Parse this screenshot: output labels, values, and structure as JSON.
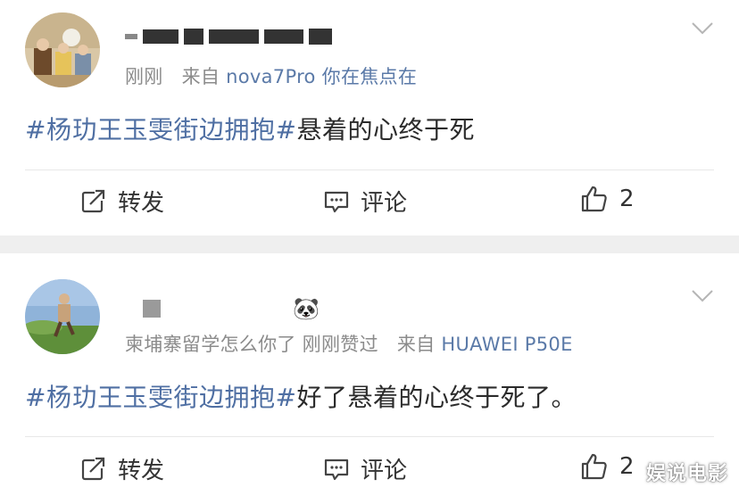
{
  "colors": {
    "hashtag": "#4f6fa3",
    "meta": "#8b8b8b",
    "source": "#5b7aa8",
    "separator": "#efefef"
  },
  "posts": [
    {
      "meta_time": "刚刚",
      "meta_from": "来自",
      "meta_source": "nova7Pro 你在焦点在",
      "hashtag": "#杨玏王玉雯街边拥抱#",
      "text": "悬着的心终于死",
      "actions": {
        "repost": "转发",
        "comment": "评论",
        "like_count": "2"
      },
      "icons": {
        "menu": "chevron-down-icon",
        "repost": "share-icon",
        "comment": "comment-icon",
        "like": "thumbs-up-icon"
      }
    },
    {
      "name_emoji": "🐼",
      "meta_prefix": "柬埔寨留学怎么你了 刚刚赞过",
      "meta_from": "来自",
      "meta_source": "HUAWEI P50E",
      "hashtag": "#杨玏王玉雯街边拥抱#",
      "text": "好了悬着的心终于死了。",
      "actions": {
        "repost": "转发",
        "comment": "评论",
        "like_count": "2"
      },
      "icons": {
        "menu": "chevron-down-icon",
        "repost": "share-icon",
        "comment": "comment-icon",
        "like": "thumbs-up-icon"
      }
    }
  ],
  "watermark": "娱说电影"
}
